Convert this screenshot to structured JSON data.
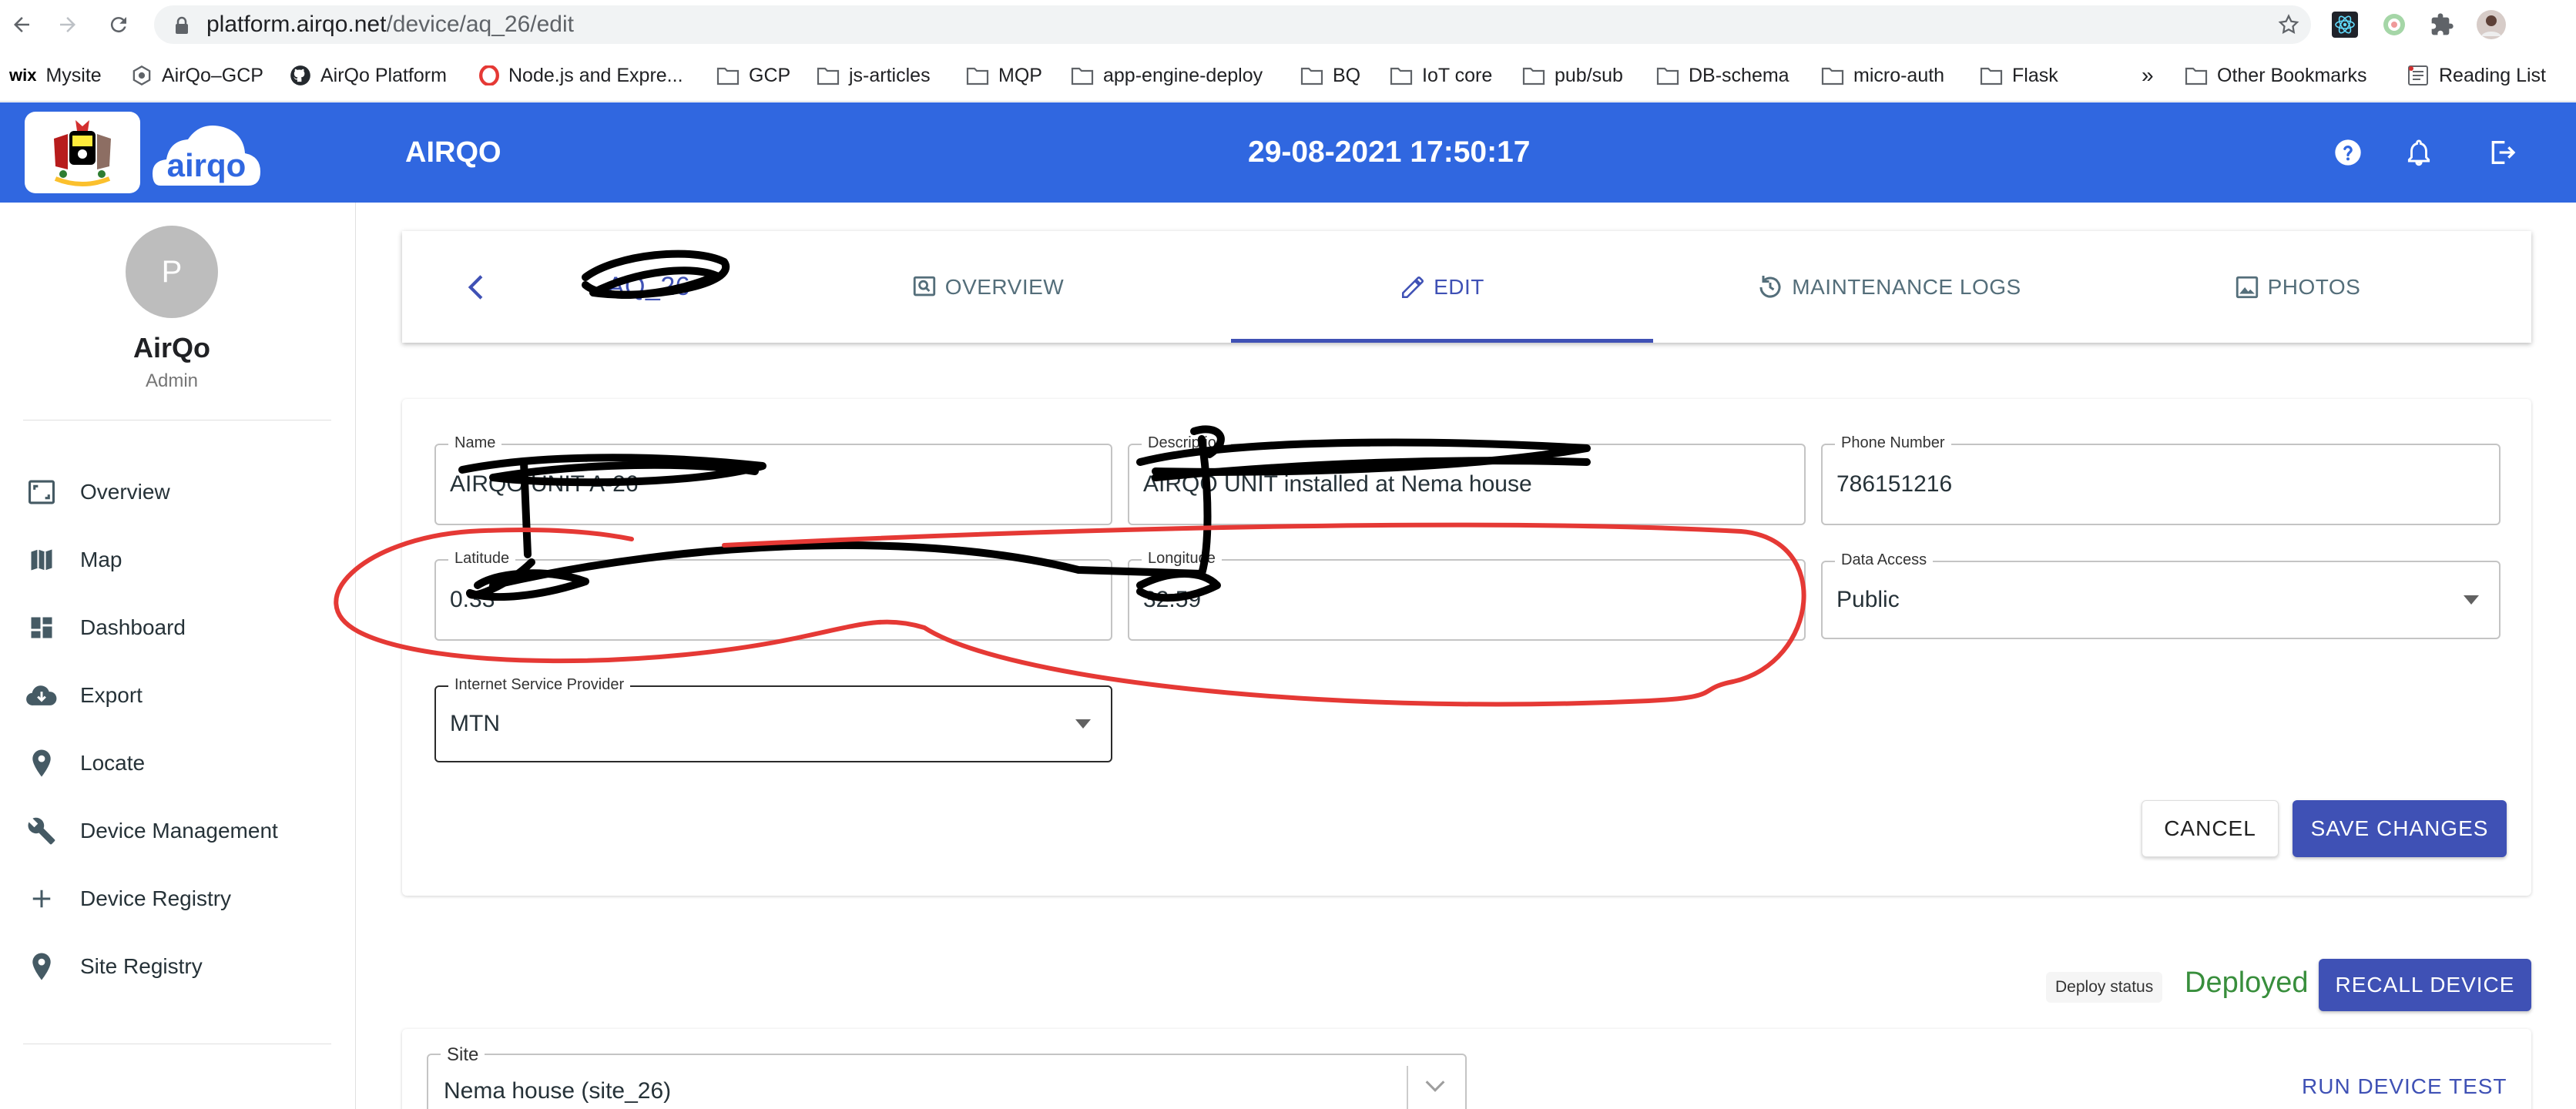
{
  "browser": {
    "url_host": "platform.airqo.net",
    "url_path": "/device/aq_26/edit",
    "bookmarks": [
      "Mysite",
      "AirQo–GCP",
      "AirQo Platform",
      "Node.js and Expre...",
      "GCP",
      "js-articles",
      "MQP",
      "app-engine-deploy",
      "BQ",
      "IoT core",
      "pub/sub",
      "DB-schema",
      "micro-auth",
      "Flask"
    ],
    "overflow": "»",
    "other_bookmarks": "Other Bookmarks",
    "reading_list": "Reading List"
  },
  "header": {
    "logo_text": "airqo",
    "title": "AIRQO",
    "datetime": "29-08-2021 17:50:17",
    "brand_color": "#3067e0"
  },
  "sidebar": {
    "avatar_initial": "P",
    "user_name": "AirQo",
    "user_role": "Admin",
    "items": [
      {
        "label": "Overview",
        "icon": "overview-icon"
      },
      {
        "label": "Map",
        "icon": "map-icon"
      },
      {
        "label": "Dashboard",
        "icon": "dashboard-icon"
      },
      {
        "label": "Export",
        "icon": "cloud-download-icon"
      },
      {
        "label": "Locate",
        "icon": "location-pin-icon"
      },
      {
        "label": "Device Management",
        "icon": "wrench-icon"
      },
      {
        "label": "Device Registry",
        "icon": "plus-icon"
      },
      {
        "label": "Site Registry",
        "icon": "location-pin-icon"
      }
    ]
  },
  "tabs": {
    "device_name": "AQ_26",
    "items": [
      {
        "label": "OVERVIEW",
        "icon": "overview-icon"
      },
      {
        "label": "EDIT",
        "icon": "pencil-icon"
      },
      {
        "label": "MAINTENANCE LOGS",
        "icon": "history-icon"
      },
      {
        "label": "PHOTOS",
        "icon": "image-icon"
      }
    ],
    "active": "EDIT"
  },
  "form": {
    "name": {
      "label": "Name",
      "value": "AIRQO UNIT A-26"
    },
    "description": {
      "label": "Description",
      "value": "AIRQO UNIT installed at Nema house"
    },
    "phone": {
      "label": "Phone Number",
      "value": "786151216"
    },
    "latitude": {
      "label": "Latitude",
      "value": "0.33"
    },
    "longitude": {
      "label": "Longitude",
      "value": "32.59"
    },
    "data_access": {
      "label": "Data Access",
      "value": "Public"
    },
    "isp": {
      "label": "Internet Service Provider",
      "value": "MTN"
    },
    "cancel_label": "CANCEL",
    "save_label": "SAVE CHANGES"
  },
  "deploy": {
    "status_label": "Deploy status",
    "status_value": "Deployed",
    "status_color": "#388e3c",
    "recall_label": "RECALL DEVICE",
    "site_label": "Site",
    "site_value": "Nema house (site_26)",
    "run_test_label": "RUN DEVICE TEST"
  }
}
